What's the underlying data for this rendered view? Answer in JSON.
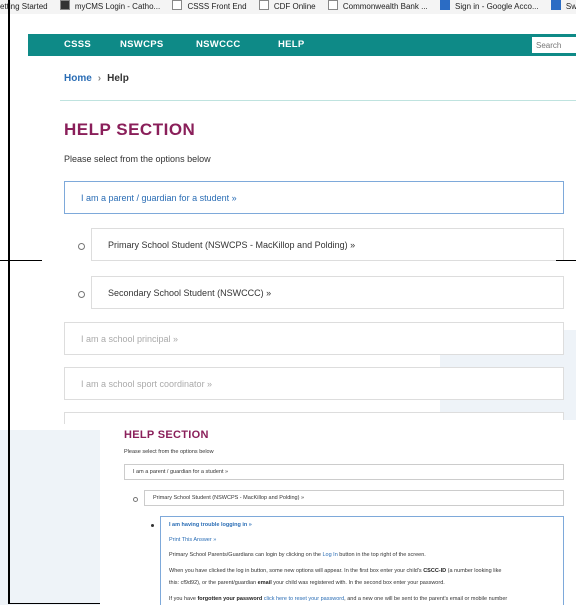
{
  "bookmarks": [
    {
      "label": "etting Started",
      "icon": "page-icon"
    },
    {
      "label": "myCMS Login - Catho...",
      "icon": "mycms-icon"
    },
    {
      "label": "CSSS Front End",
      "icon": "page-icon"
    },
    {
      "label": "CDF Online",
      "icon": "page-icon"
    },
    {
      "label": "Commonwealth Bank ...",
      "icon": "page-icon"
    },
    {
      "label": "Sign in - Google Acco...",
      "icon": "google-icon"
    },
    {
      "label": "Sw",
      "icon": "page-icon"
    }
  ],
  "nav": {
    "items": [
      "CSSS",
      "NSWCPS",
      "NSWCCC",
      "HELP"
    ],
    "search_placeholder": "Search",
    "color": "#0e8a87"
  },
  "breadcrumb": {
    "home": "Home",
    "separator": "›",
    "current": "Help"
  },
  "page": {
    "title": "HELP SECTION",
    "subtitle": "Please select from the options below",
    "title_color": "#8a1f5a"
  },
  "options": {
    "parent": "I am a parent / guardian for a student »",
    "primary": "Primary School Student (NSWCPS - MacKillop and Polding) »",
    "secondary": "Secondary School Student (NSWCCC) »",
    "principal": "I am a school principal »",
    "coordinator": "I am a school sport coordinator »"
  },
  "inset": {
    "title": "HELP SECTION",
    "subtitle": "Please select from the options below",
    "parent": "I am a parent / guardian for a student »",
    "primary": "Primary School Student (NSWCPS - MacKillop and Polding) »",
    "question": "I am having trouble logging in »",
    "print": "Print This Answer »",
    "line1_a": "Primary School Parents/Guardians can login by clicking on the ",
    "line1_link": "Log In",
    "line1_b": " button in the top right of the screen.",
    "line2_a": "When you have clicked the log in button, some new options will appear. In the first box enter your child's ",
    "line2_bold": "CSCC-ID",
    "line2_b": " (a number looking like",
    "line3_a": "this: cf9d92), or the parent/guardian ",
    "line3_bold": "email",
    "line3_b": " your child was registered with. In the second box enter your password.",
    "line4_a": "If you have ",
    "line4_bold": "forgotten your password",
    "line4_link": " click here to reset your password",
    "line4_b": ", and a new one will be sent to the parent's email or mobile number"
  }
}
